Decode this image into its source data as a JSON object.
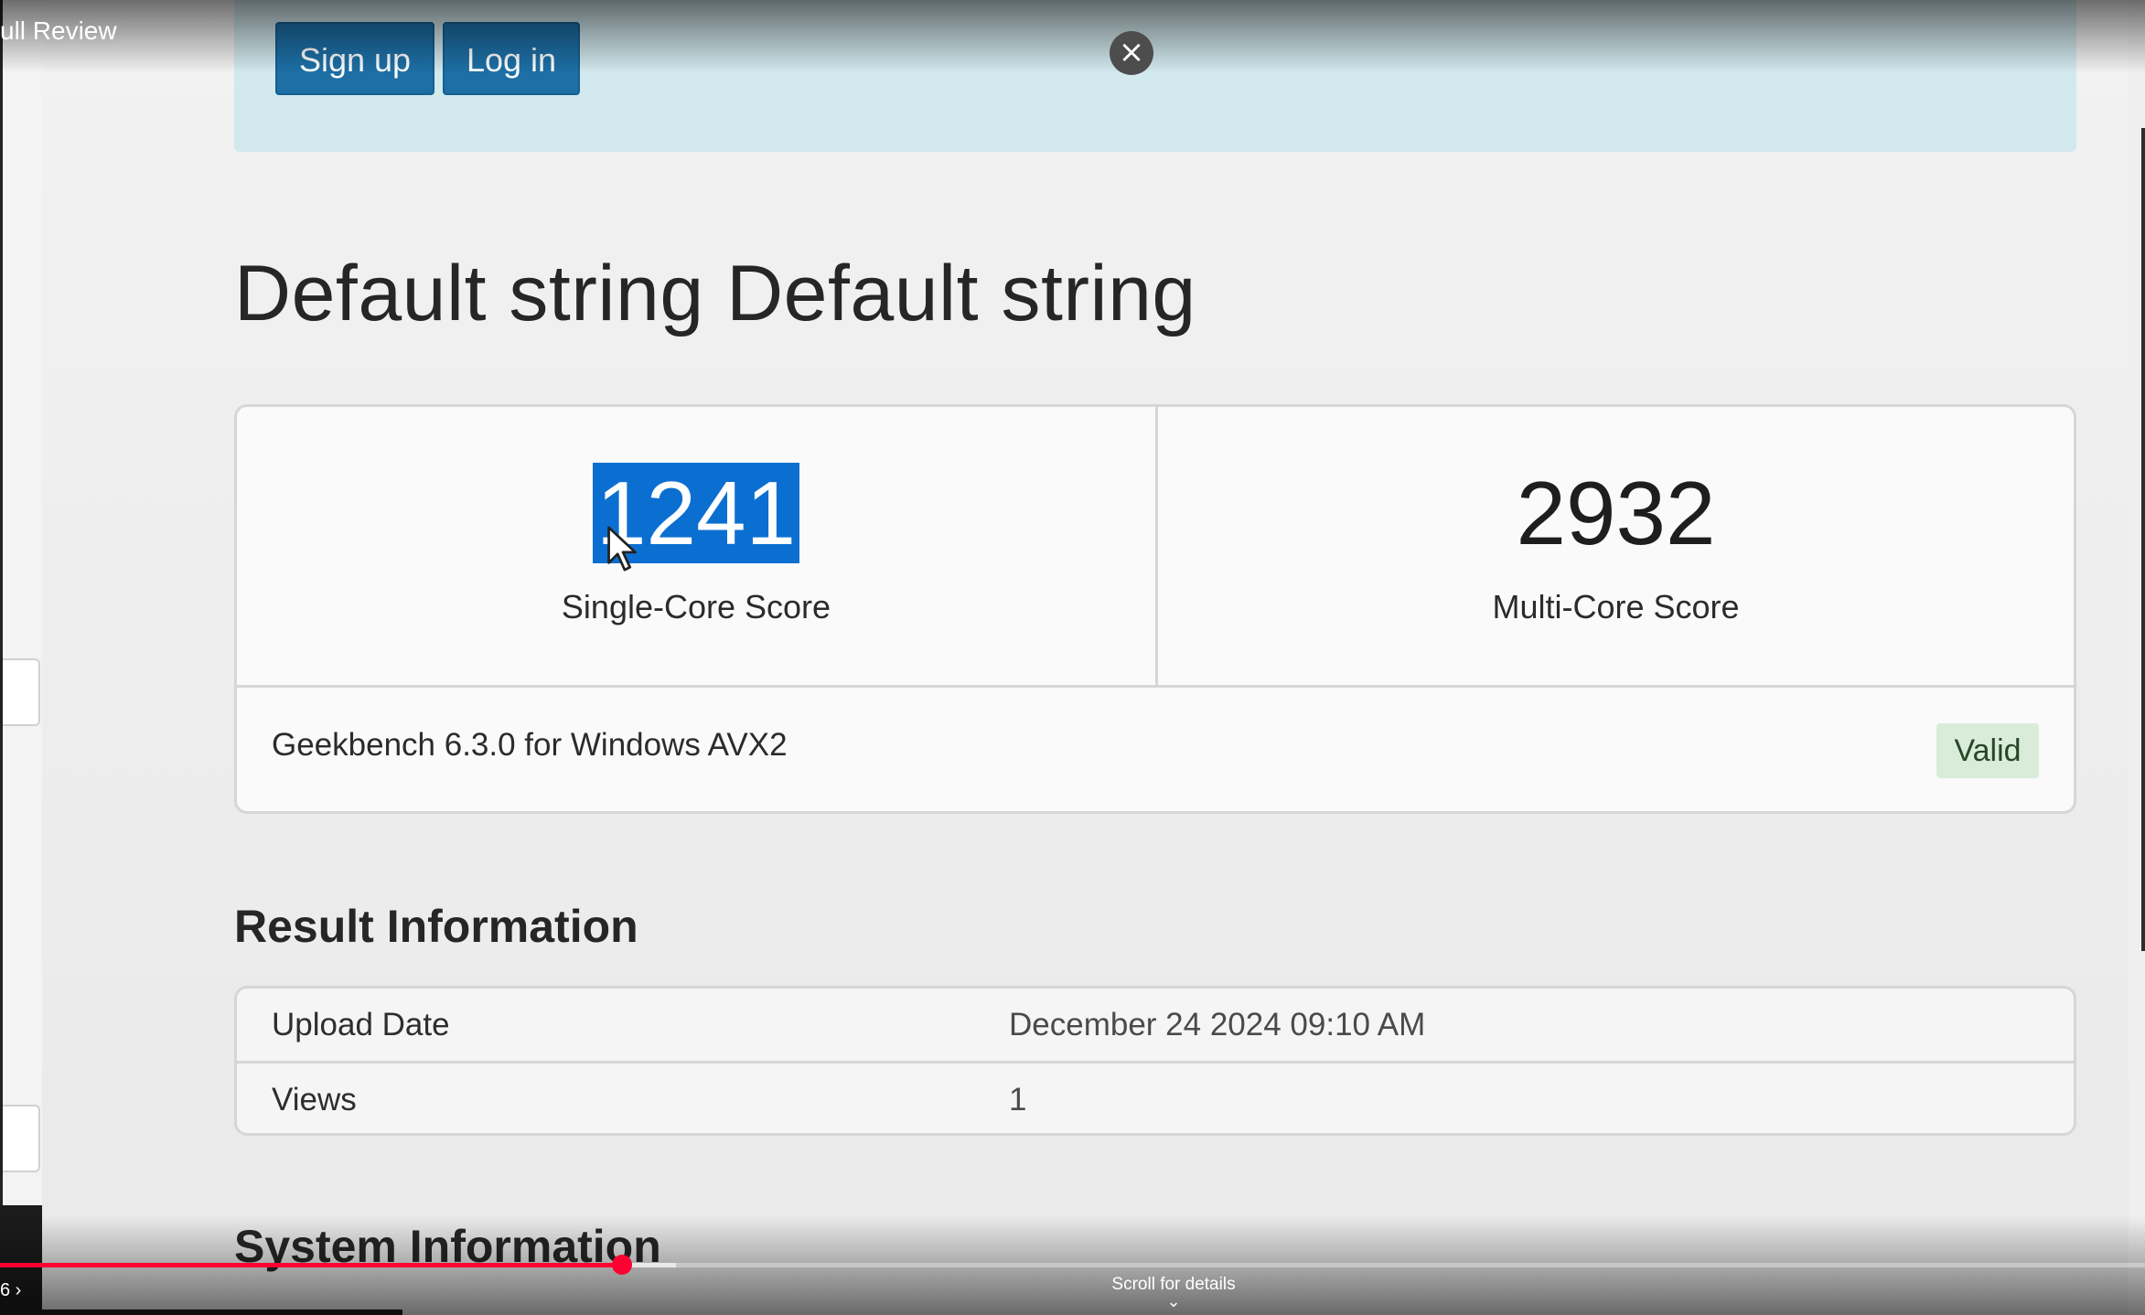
{
  "video": {
    "title": "ull Review",
    "time_text": "6 ›",
    "progress_fraction": 0.29,
    "buffer_fraction": 0.315,
    "scroll_hint": "Scroll for details",
    "accent_color": "#ff0033"
  },
  "auth": {
    "signup_label": "Sign up",
    "login_label": "Log in",
    "close_glyph": "×"
  },
  "page": {
    "title": "Default string Default string"
  },
  "scores": {
    "single": {
      "value": "1241",
      "label": "Single-Core Score"
    },
    "multi": {
      "value": "2932",
      "label": "Multi-Core Score"
    },
    "version": "Geekbench 6.3.0 for Windows AVX2",
    "status": "Valid"
  },
  "result_info": {
    "title": "Result Information",
    "rows": [
      {
        "key": "Upload Date",
        "value": "December 24 2024 09:10 AM"
      },
      {
        "key": "Views",
        "value": "1"
      }
    ]
  },
  "system_info": {
    "title": "System Information"
  },
  "colors": {
    "button_blue": "#1d6fa6",
    "banner_bg": "#d2e9ee",
    "selection_blue": "#0b6fd1",
    "valid_bg": "#d9ecd9"
  }
}
